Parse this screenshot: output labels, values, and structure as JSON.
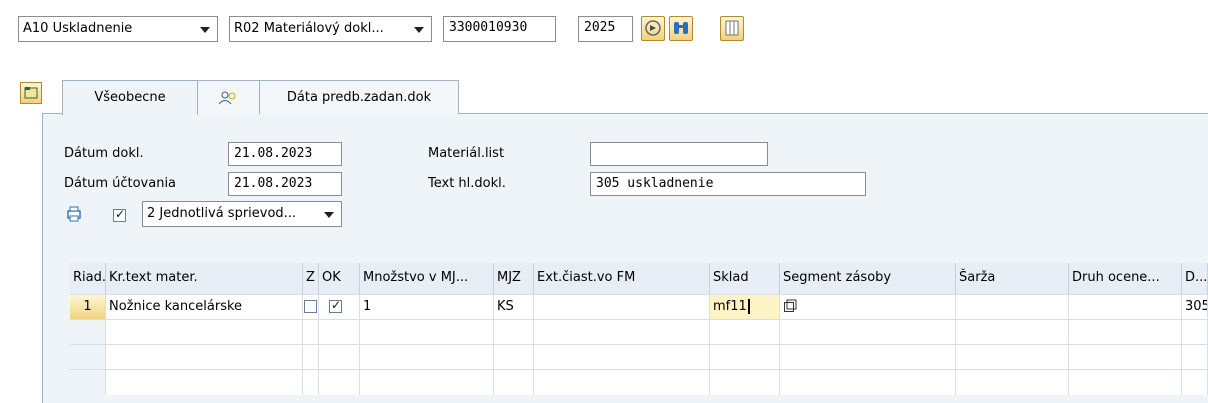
{
  "toolbar": {
    "transaction": "A10 Uskladnenie",
    "reference": "R02 Materiálový dokl...",
    "doc_number": "3300010930",
    "year": "2025"
  },
  "tabs": [
    {
      "label": "Všeobecne",
      "active": true
    },
    {
      "label": "",
      "icon": "partner-icon"
    },
    {
      "label": "Dáta predb.zadan.dok"
    }
  ],
  "header": {
    "doc_date_label": "Dátum dokl.",
    "doc_date": "21.08.2023",
    "posting_date_label": "Dátum účtovania",
    "posting_date": "21.08.2023",
    "material_slip_label": "Materiál.list",
    "material_slip": "",
    "header_text_label": "Text hl.dokl.",
    "header_text": "305 uskladnenie",
    "print_checked": true,
    "print_option": "2 Jednotlivá sprievod..."
  },
  "table": {
    "columns": [
      "Riad.",
      "Kr.text mater.",
      "Z",
      "OK",
      "Množstvo v MJ...",
      "MJZ",
      "Ext.čiast.vo FM",
      "Sklad",
      "Segment zásoby",
      "Šarža",
      "Druh ocene...",
      "D..."
    ],
    "rows": [
      {
        "line": "1",
        "material_text": "Nožnice kancelárske",
        "z": false,
        "ok": true,
        "quantity": "1",
        "unit": "KS",
        "ext_amount": "",
        "storage": "mf11",
        "segment": "",
        "batch": "",
        "valuation": "",
        "d": "305"
      }
    ]
  },
  "colors": {
    "accent": "#f1d27d",
    "panel": "#eff4f9",
    "border": "#9fb3c7"
  }
}
